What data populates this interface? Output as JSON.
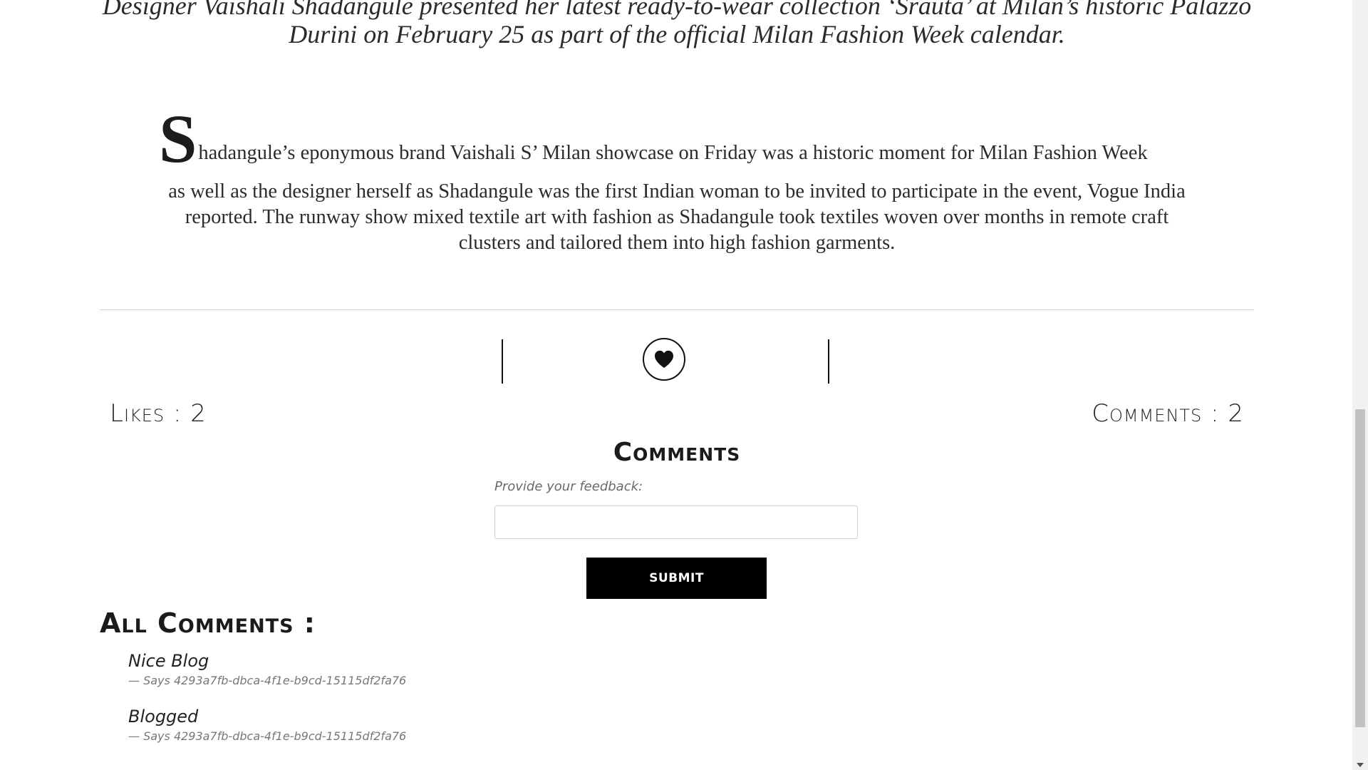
{
  "article": {
    "lead": "Designer Vaishali Shadangule presented her latest ready-to-wear collection ‘Srauta’ at Milan’s historic Palazzo Durini on February 25 as part of the official Milan Fashion Week calendar.",
    "dropcap": "S",
    "para_line1": "hadangule’s eponymous brand Vaishali S’ Milan showcase on Friday was a historic moment for Milan Fashion Week",
    "para_rest": "as well as the designer herself as Shadangule was the first Indian woman to be invited to participate in the event, Vogue India reported. The runway show mixed textile art with fashion as Shadangule took textiles woven over months in remote craft clusters and tailored them into high fashion garments."
  },
  "engagement": {
    "like_icon": "heart-icon",
    "likes_label": "Likes : 2",
    "comments_label": "Comments : 2"
  },
  "comment_form": {
    "title": "Comments",
    "feedback_label": "Provide your feedback:",
    "input_value": "",
    "submit_label": "SUBMIT"
  },
  "all_comments": {
    "title": "All Comments :",
    "items": [
      {
        "text": "Nice Blog",
        "author": "— Says 4293a7fb-dbca-4f1e-b9cd-15115df2fa76"
      },
      {
        "text": "Blogged",
        "author": "— Says 4293a7fb-dbca-4f1e-b9cd-15115df2fa76"
      }
    ]
  },
  "colors": {
    "button_bg": "#000000",
    "divider": "#cfcfcf",
    "muted_text": "#777777"
  }
}
